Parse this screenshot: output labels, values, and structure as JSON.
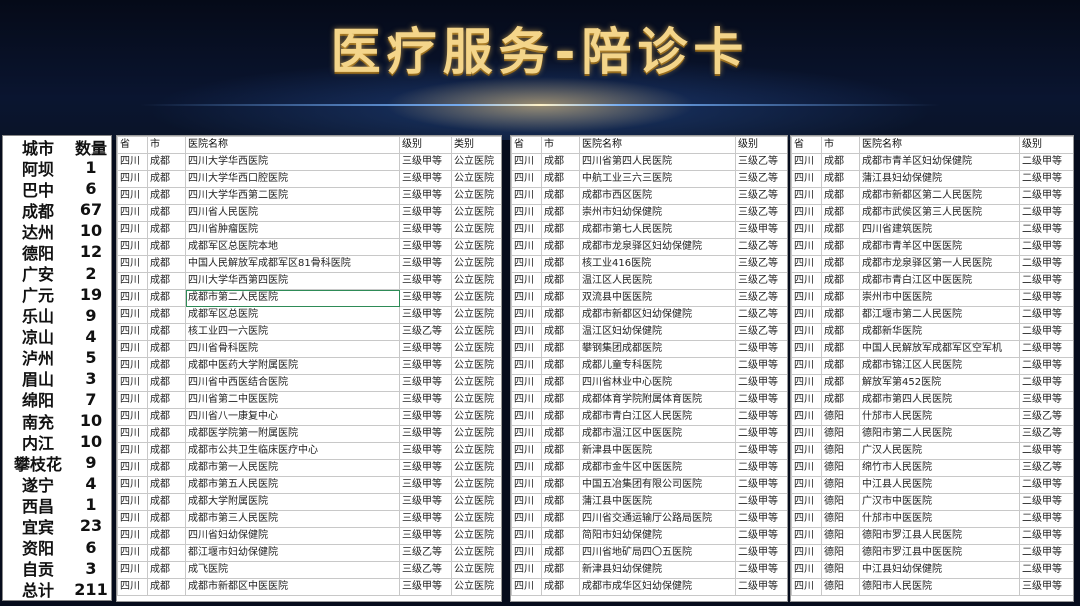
{
  "title": "医疗服务-陪诊卡",
  "summary": {
    "headers": [
      "城市",
      "数量"
    ],
    "rows": [
      [
        "阿坝",
        "1"
      ],
      [
        "巴中",
        "6"
      ],
      [
        "成都",
        "67"
      ],
      [
        "达州",
        "10"
      ],
      [
        "德阳",
        "12"
      ],
      [
        "广安",
        "2"
      ],
      [
        "广元",
        "19"
      ],
      [
        "乐山",
        "9"
      ],
      [
        "凉山",
        "4"
      ],
      [
        "泸州",
        "5"
      ],
      [
        "眉山",
        "3"
      ],
      [
        "绵阳",
        "7"
      ],
      [
        "南充",
        "10"
      ],
      [
        "内江",
        "10"
      ],
      [
        "攀枝花",
        "9"
      ],
      [
        "遂宁",
        "4"
      ],
      [
        "西昌",
        "1"
      ],
      [
        "宜宾",
        "23"
      ],
      [
        "资阳",
        "6"
      ],
      [
        "自贡",
        "3"
      ],
      [
        "总计",
        "211"
      ]
    ]
  },
  "table1": {
    "headers": [
      "省",
      "市",
      "医院名称",
      "级别",
      "类别"
    ],
    "rows": [
      [
        "四川",
        "成都",
        "四川大学华西医院",
        "三级甲等",
        "公立医院"
      ],
      [
        "四川",
        "成都",
        "四川大学华西口腔医院",
        "三级甲等",
        "公立医院"
      ],
      [
        "四川",
        "成都",
        "四川大学华西第二医院",
        "三级甲等",
        "公立医院"
      ],
      [
        "四川",
        "成都",
        "四川省人民医院",
        "三级甲等",
        "公立医院"
      ],
      [
        "四川",
        "成都",
        "四川省肿瘤医院",
        "三级甲等",
        "公立医院"
      ],
      [
        "四川",
        "成都",
        "成都军区总医院本地",
        "三级甲等",
        "公立医院"
      ],
      [
        "四川",
        "成都",
        "中国人民解放军成都军区81骨科医院",
        "三级甲等",
        "公立医院"
      ],
      [
        "四川",
        "成都",
        "四川大学华西第四医院",
        "三级甲等",
        "公立医院"
      ],
      [
        "四川",
        "成都",
        "成都市第二人民医院",
        "三级甲等",
        "公立医院"
      ],
      [
        "四川",
        "成都",
        "成都军区总医院",
        "三级甲等",
        "公立医院"
      ],
      [
        "四川",
        "成都",
        "核工业四一六医院",
        "三级乙等",
        "公立医院"
      ],
      [
        "四川",
        "成都",
        "四川省骨科医院",
        "三级甲等",
        "公立医院"
      ],
      [
        "四川",
        "成都",
        "成都中医药大学附属医院",
        "三级甲等",
        "公立医院"
      ],
      [
        "四川",
        "成都",
        "四川省中西医结合医院",
        "三级甲等",
        "公立医院"
      ],
      [
        "四川",
        "成都",
        "四川省第二中医医院",
        "三级甲等",
        "公立医院"
      ],
      [
        "四川",
        "成都",
        "四川省八一康复中心",
        "三级甲等",
        "公立医院"
      ],
      [
        "四川",
        "成都",
        "成都医学院第一附属医院",
        "三级甲等",
        "公立医院"
      ],
      [
        "四川",
        "成都",
        "成都市公共卫生临床医疗中心",
        "三级甲等",
        "公立医院"
      ],
      [
        "四川",
        "成都",
        "成都市第一人民医院",
        "三级甲等",
        "公立医院"
      ],
      [
        "四川",
        "成都",
        "成都市第五人民医院",
        "三级甲等",
        "公立医院"
      ],
      [
        "四川",
        "成都",
        "成都大学附属医院",
        "三级甲等",
        "公立医院"
      ],
      [
        "四川",
        "成都",
        "成都市第三人民医院",
        "三级甲等",
        "公立医院"
      ],
      [
        "四川",
        "成都",
        "四川省妇幼保健院",
        "三级甲等",
        "公立医院"
      ],
      [
        "四川",
        "成都",
        "都江堰市妇幼保健院",
        "三级乙等",
        "公立医院"
      ],
      [
        "四川",
        "成都",
        "成飞医院",
        "三级乙等",
        "公立医院"
      ],
      [
        "四川",
        "成都",
        "成都市新都区中医医院",
        "三级甲等",
        "公立医院"
      ]
    ]
  },
  "table2": {
    "headers": [
      "省",
      "市",
      "医院名称",
      "级别"
    ],
    "rows": [
      [
        "四川",
        "成都",
        "四川省第四人民医院",
        "三级乙等"
      ],
      [
        "四川",
        "成都",
        "中航工业三六三医院",
        "三级乙等"
      ],
      [
        "四川",
        "成都",
        "成都市西区医院",
        "三级乙等"
      ],
      [
        "四川",
        "成都",
        "崇州市妇幼保健院",
        "三级乙等"
      ],
      [
        "四川",
        "成都",
        "成都市第七人民医院",
        "三级甲等"
      ],
      [
        "四川",
        "成都",
        "成都市龙泉驿区妇幼保健院",
        "二级乙等"
      ],
      [
        "四川",
        "成都",
        "核工业416医院",
        "三级乙等"
      ],
      [
        "四川",
        "成都",
        "温江区人民医院",
        "三级乙等"
      ],
      [
        "四川",
        "成都",
        "双流县中医医院",
        "三级乙等"
      ],
      [
        "四川",
        "成都",
        "成都市新都区妇幼保健院",
        "二级乙等"
      ],
      [
        "四川",
        "成都",
        "温江区妇幼保健院",
        "三级乙等"
      ],
      [
        "四川",
        "成都",
        "攀钢集团成都医院",
        "二级甲等"
      ],
      [
        "四川",
        "成都",
        "成都儿童专科医院",
        "二级甲等"
      ],
      [
        "四川",
        "成都",
        "四川省林业中心医院",
        "二级甲等"
      ],
      [
        "四川",
        "成都",
        "成都体育学院附属体育医院",
        "二级甲等"
      ],
      [
        "四川",
        "成都",
        "成都市青白江区人民医院",
        "二级甲等"
      ],
      [
        "四川",
        "成都",
        "成都市温江区中医医院",
        "二级甲等"
      ],
      [
        "四川",
        "成都",
        "新津县中医医院",
        "二级甲等"
      ],
      [
        "四川",
        "成都",
        "成都市金牛区中医医院",
        "二级甲等"
      ],
      [
        "四川",
        "成都",
        "中国五冶集团有限公司医院",
        "二级甲等"
      ],
      [
        "四川",
        "成都",
        "蒲江县中医医院",
        "二级甲等"
      ],
      [
        "四川",
        "成都",
        "四川省交通运输厅公路局医院",
        "二级甲等"
      ],
      [
        "四川",
        "成都",
        "简阳市妇幼保健院",
        "二级甲等"
      ],
      [
        "四川",
        "成都",
        "四川省地矿局四〇五医院",
        "二级甲等"
      ],
      [
        "四川",
        "成都",
        "新津县妇幼保健院",
        "二级甲等"
      ],
      [
        "四川",
        "成都",
        "成都市成华区妇幼保健院",
        "二级甲等"
      ]
    ]
  },
  "table3": {
    "headers": [
      "省",
      "市",
      "医院名称",
      "级别"
    ],
    "rows": [
      [
        "四川",
        "成都",
        "成都市青羊区妇幼保健院",
        "二级甲等"
      ],
      [
        "四川",
        "成都",
        "蒲江县妇幼保健院",
        "二级甲等"
      ],
      [
        "四川",
        "成都",
        "成都市新都区第二人民医院",
        "二级甲等"
      ],
      [
        "四川",
        "成都",
        "成都市武侯区第三人民医院",
        "二级甲等"
      ],
      [
        "四川",
        "成都",
        "四川省建筑医院",
        "二级甲等"
      ],
      [
        "四川",
        "成都",
        "成都市青羊区中医医院",
        "二级甲等"
      ],
      [
        "四川",
        "成都",
        "成都市龙泉驿区第一人民医院",
        "二级甲等"
      ],
      [
        "四川",
        "成都",
        "成都市青白江区中医医院",
        "二级甲等"
      ],
      [
        "四川",
        "成都",
        "崇州市中医医院",
        "二级甲等"
      ],
      [
        "四川",
        "成都",
        "都江堰市第二人民医院",
        "二级甲等"
      ],
      [
        "四川",
        "成都",
        "成都新华医院",
        "二级甲等"
      ],
      [
        "四川",
        "成都",
        "中国人民解放军成都军区空军机",
        "二级甲等"
      ],
      [
        "四川",
        "成都",
        "成都市锦江区人民医院",
        "二级甲等"
      ],
      [
        "四川",
        "成都",
        "解放军第452医院",
        "二级甲等"
      ],
      [
        "四川",
        "成都",
        "成都市第四人民医院",
        "三级甲等"
      ],
      [
        "四川",
        "德阳",
        "什邡市人民医院",
        "三级乙等"
      ],
      [
        "四川",
        "德阳",
        "德阳市第二人民医院",
        "三级乙等"
      ],
      [
        "四川",
        "德阳",
        "广汉人民医院",
        "二级甲等"
      ],
      [
        "四川",
        "德阳",
        "绵竹市人民医院",
        "三级乙等"
      ],
      [
        "四川",
        "德阳",
        "中江县人民医院",
        "二级甲等"
      ],
      [
        "四川",
        "德阳",
        "广汉市中医医院",
        "二级甲等"
      ],
      [
        "四川",
        "德阳",
        "什邡市中医医院",
        "二级甲等"
      ],
      [
        "四川",
        "德阳",
        "德阳市罗江县人民医院",
        "二级甲等"
      ],
      [
        "四川",
        "德阳",
        "德阳市罗江县中医医院",
        "二级甲等"
      ],
      [
        "四川",
        "德阳",
        "中江县妇幼保健院",
        "二级甲等"
      ],
      [
        "四川",
        "德阳",
        "德阳市人民医院",
        "三级甲等"
      ]
    ]
  }
}
